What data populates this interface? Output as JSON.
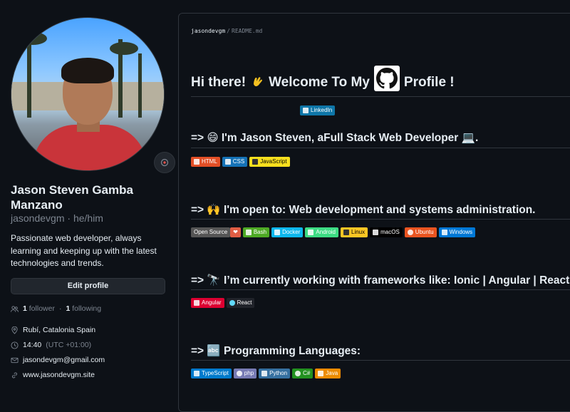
{
  "profile": {
    "full_name": "Jason Steven Gamba Manzano",
    "username": "jasondevgm",
    "pronouns": "he/him",
    "bio": "Passionate web developer, always learning and keeping up with the latest technologies and trends.",
    "edit_label": "Edit profile",
    "followers_count": "1",
    "followers_label": "follower",
    "following_count": "1",
    "following_label": "following",
    "location": "Rubí, Catalonia Spain",
    "local_time": "14:40",
    "timezone": "(UTC +01:00)",
    "email": "jasondevgm@gmail.com",
    "website": "www.jasondevgm.site"
  },
  "readme": {
    "owner": "jasondevgm",
    "file": "README.md",
    "heading_pre": "Hi there!",
    "heading_mid": "Welcome To My",
    "heading_post": "Profile !",
    "linkedin_label": "LinkedIn",
    "intro": "=> 😄 I'm Jason Steven, aFull Stack Web Developer 💻.",
    "open_to": "=> 🙌 I'm open to: Web development and systems administration.",
    "frameworks": "=> 🔭 I’m currently working with frameworks like: Ionic | Angular | React",
    "languages": "=> 🔤 Programming Languages:"
  },
  "badges": {
    "web": [
      {
        "label": "HTML",
        "color": "#e34f26"
      },
      {
        "label": "CSS",
        "color": "#1572b6"
      },
      {
        "label": "JavaScript",
        "color": "#f7df1e",
        "text": "#000000"
      }
    ],
    "tools": [
      {
        "label": "Open Source",
        "color": "#555555"
      },
      {
        "label": "❤",
        "color": "#e05d44"
      },
      {
        "label": "Bash",
        "color": "#4eaa25"
      },
      {
        "label": "Docker",
        "color": "#0db7ed"
      },
      {
        "label": "Android",
        "color": "#3ddc84"
      },
      {
        "label": "Linux",
        "color": "#fcc624",
        "text": "#000000"
      },
      {
        "label": "macOS",
        "color": "#000000"
      },
      {
        "label": "Ubuntu",
        "color": "#e95420"
      },
      {
        "label": "Windows",
        "color": "#0078d6"
      }
    ],
    "frameworks": [
      {
        "label": "Angular",
        "color": "#dd0031"
      },
      {
        "label": "React",
        "color": "#20232a"
      }
    ],
    "languages": [
      {
        "label": "TypeScript",
        "color": "#007acc"
      },
      {
        "label": "php",
        "color": "#777bb4"
      },
      {
        "label": "Python",
        "color": "#3670a0"
      },
      {
        "label": "C#",
        "color": "#239120"
      },
      {
        "label": "Java",
        "color": "#ed8b00"
      }
    ]
  }
}
